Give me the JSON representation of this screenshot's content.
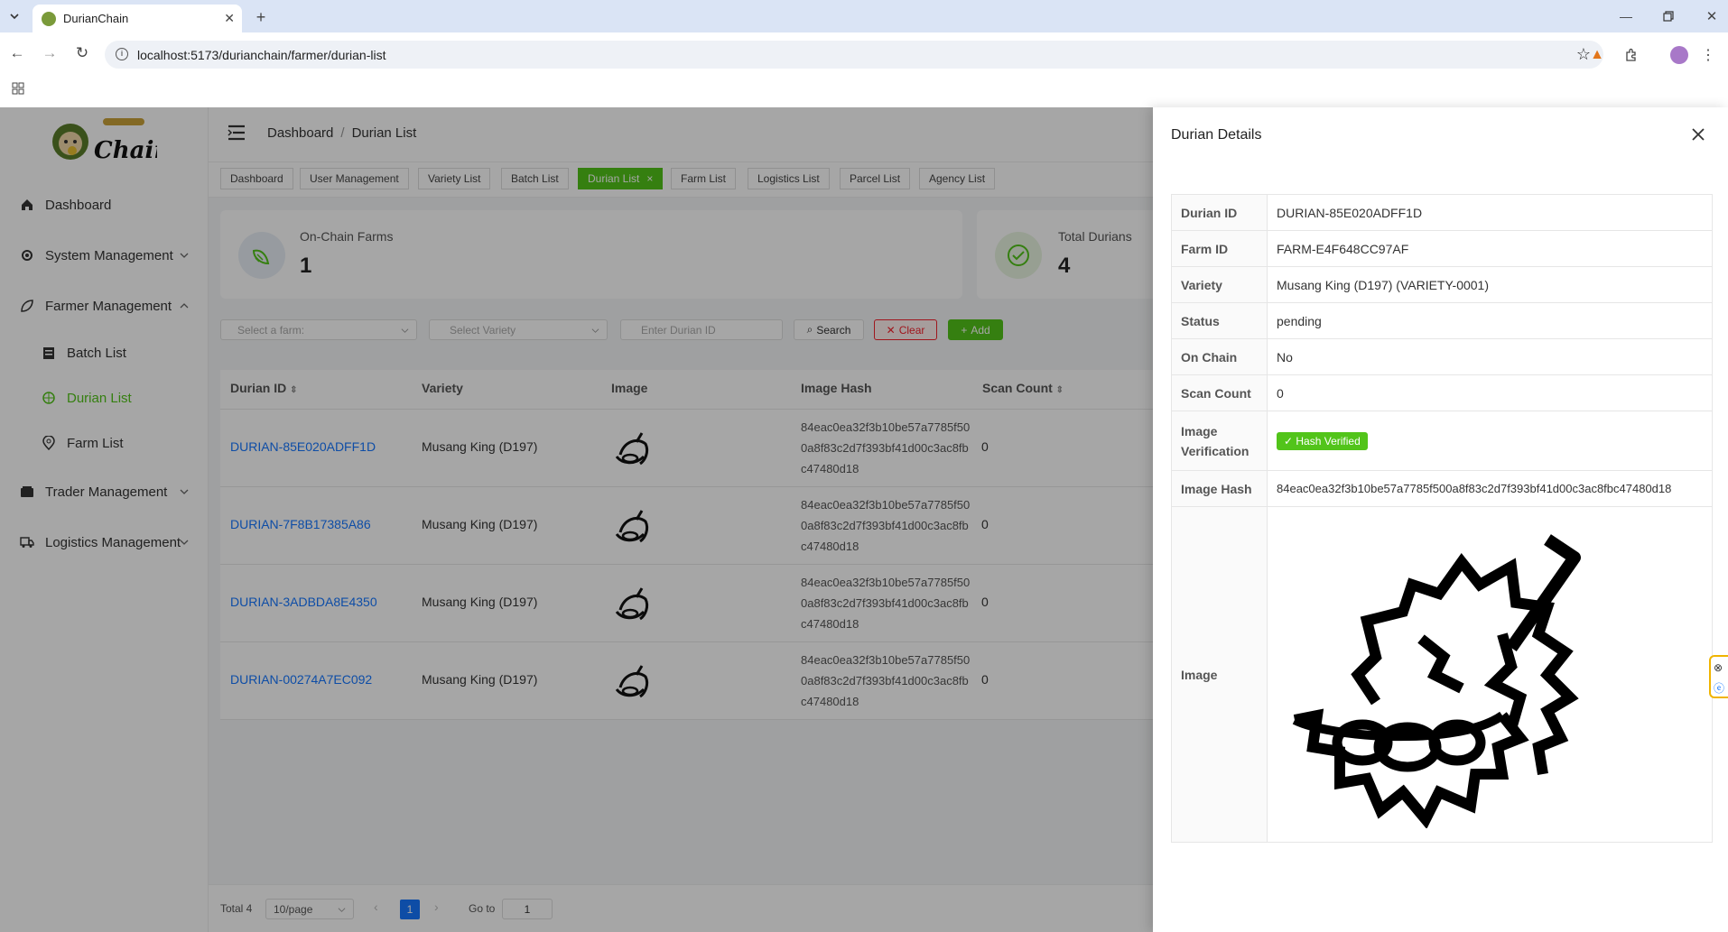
{
  "browser": {
    "tab_title": "DurianChain",
    "url": "localhost:5173/durianchain/farmer/durian-list"
  },
  "app": {
    "logo_text": "Chain",
    "breadcrumb": [
      "Dashboard",
      "/",
      "Durian List"
    ],
    "tags": [
      "Dashboard",
      "User Management",
      "Variety List",
      "Batch List",
      "Durian List",
      "Farm List",
      "Logistics List",
      "Parcel List",
      "Agency List"
    ],
    "tag_close": "×"
  },
  "sidebar": {
    "items": [
      {
        "label": "Dashboard",
        "icon": "home-icon"
      },
      {
        "label": "System Management",
        "icon": "gear-icon"
      },
      {
        "label": "Farmer Management",
        "icon": "leaf-icon"
      },
      {
        "label": "Batch List",
        "icon": "batch-icon"
      },
      {
        "label": "Durian List",
        "icon": "durian-icon"
      },
      {
        "label": "Farm List",
        "icon": "location-icon"
      },
      {
        "label": "Trader Management",
        "icon": "wallet-icon"
      },
      {
        "label": "Logistics Management",
        "icon": "truck-icon"
      }
    ],
    "active_color": "#52c41a"
  },
  "stats": [
    {
      "label": "On-Chain Farms",
      "value": "1"
    },
    {
      "label": "Total Durians",
      "value": "4"
    }
  ],
  "filters": {
    "farm_placeholder": "Select a farm:",
    "variety_placeholder": "Select Variety",
    "durian_placeholder": "Enter Durian ID",
    "search": "Search",
    "clear": "Clear",
    "add": "Add"
  },
  "table": {
    "columns": [
      "Durian ID",
      "Variety",
      "Image",
      "Image Hash",
      "Scan Count"
    ],
    "rows": [
      {
        "id": "DURIAN-85E020ADFF1D",
        "variety": "Musang King (D197)",
        "hash": "84eac0ea32f3b10be57a7785f500a8f83c2d7f393bf41d00c3ac8fbc47480d18",
        "scan": "0"
      },
      {
        "id": "DURIAN-7F8B17385A86",
        "variety": "Musang King (D197)",
        "hash": "84eac0ea32f3b10be57a7785f500a8f83c2d7f393bf41d00c3ac8fbc47480d18",
        "scan": "0"
      },
      {
        "id": "DURIAN-3ADBDA8E4350",
        "variety": "Musang King (D197)",
        "hash": "84eac0ea32f3b10be57a7785f500a8f83c2d7f393bf41d00c3ac8fbc47480d18",
        "scan": "0"
      },
      {
        "id": "DURIAN-00274A7EC092",
        "variety": "Musang King (D197)",
        "hash": "84eac0ea32f3b10be57a7785f500a8f83c2d7f393bf41d00c3ac8fbc47480d18",
        "scan": "0"
      }
    ]
  },
  "pagination": {
    "total": "Total 4",
    "page_size": "10/page",
    "current": "1",
    "goto_label": "Go to",
    "goto_value": "1"
  },
  "drawer": {
    "title": "Durian Details",
    "rows": [
      {
        "k": "Durian ID",
        "v": "DURIAN-85E020ADFF1D"
      },
      {
        "k": "Farm ID",
        "v": "FARM-E4F648CC97AF"
      },
      {
        "k": "Variety",
        "v": "Musang King (D197) (VARIETY-0001)"
      },
      {
        "k": "Status",
        "v": "pending"
      },
      {
        "k": "On Chain",
        "v": "No"
      },
      {
        "k": "Scan Count",
        "v": "0"
      },
      {
        "k": "Image Verification",
        "v": "✓ Hash Verified"
      },
      {
        "k": "Image Hash",
        "v": "84eac0ea32f3b10be57a7785f500a8f83c2d7f393bf41d00c3ac8fbc47480d18"
      },
      {
        "k": "Image",
        "v": ""
      }
    ]
  }
}
